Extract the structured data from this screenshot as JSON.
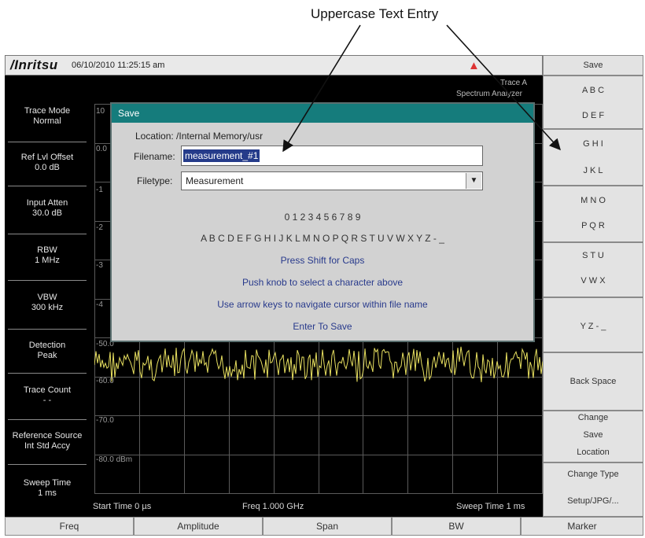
{
  "callout": "Uppercase Text Entry",
  "topbar": {
    "logo": "/Inritsu",
    "datetime": "06/10/2010 11:25:15 am"
  },
  "left_panel": [
    {
      "line1": "Trace Mode",
      "line2": "Normal"
    },
    {
      "line1": "Ref Lvl Offset",
      "line2": "0.0 dB"
    },
    {
      "line1": "Input Atten",
      "line2": "30.0 dB"
    },
    {
      "line1": "RBW",
      "line2": "1 MHz"
    },
    {
      "line1": "VBW",
      "line2": "300 kHz"
    },
    {
      "line1": "Detection",
      "line2": "Peak"
    },
    {
      "line1": "Trace Count",
      "line2": "- -"
    },
    {
      "line1": "Reference Source",
      "line2": "Int Std Accy"
    },
    {
      "line1": "Sweep Time",
      "line2": "1 ms"
    }
  ],
  "plot": {
    "trace_label": "Trace A",
    "mode_label": "Spectrum Analyzer",
    "y_labels": [
      "10",
      "0.0",
      "-1",
      "-2",
      "-3",
      "-4",
      "-50.0",
      "-60.0",
      "-70.0",
      "-80.0 dBm"
    ],
    "start_time": "Start Time  0 µs",
    "freq": "Freq 1.000 GHz",
    "sweep_time": "Sweep Time  1 ms",
    "trace_color": "#e8e060",
    "grid_color": "#5a5a5a"
  },
  "dialog": {
    "title": "Save",
    "location": "Location: /Internal Memory/usr",
    "filename_label": "Filename:",
    "filename_value": "measurement_#1",
    "filetype_label": "Filetype:",
    "filetype_value": "Measurement",
    "digits": "0 1 2 3 4 5 6 7 8 9",
    "letters": "A B C D E F G H I J K L M N O P Q R S T U V W X Y Z - _",
    "line_shift": "Press Shift for Caps",
    "line_knob": "Push knob to select a character above",
    "line_arrow": "Use arrow keys to navigate cursor within file name",
    "line_enter": "Enter To Save",
    "title_color": "#157c7c"
  },
  "right_panel": {
    "header": "Save",
    "buttons": [
      {
        "line1": "A B C",
        "line2": "D E F"
      },
      {
        "line1": "G H I",
        "line2": "J K L"
      },
      {
        "line1": "M N O",
        "line2": "P Q R"
      },
      {
        "line1": "S T U",
        "line2": "V W X"
      },
      {
        "line1": "Y Z - _"
      },
      {
        "line1": "Back Space"
      },
      {
        "line1": "Change",
        "line2": "Save",
        "line3": "Location"
      },
      {
        "line1": "Change Type",
        "line2": "Setup/JPG/..."
      }
    ]
  },
  "bottom_bar": [
    "Freq",
    "Amplitude",
    "Span",
    "BW",
    "Marker"
  ]
}
